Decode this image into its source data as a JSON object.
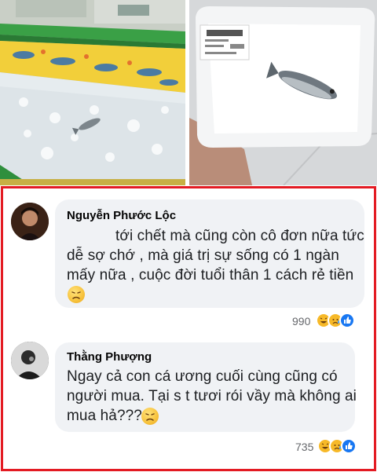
{
  "comments": [
    {
      "author": "Nguyễn Phước Lộc",
      "lines": [
        "tới chết mà cũng còn cô đơn nữa tức",
        "dễ sợ chớ , mà giá trị sự sống có 1 ngàn",
        "mấy nữa , cuộc đời tuổi thân 1 cách rẻ tiền"
      ],
      "emoji": "disappointed-face-icon",
      "reaction_count": "990",
      "reactions": [
        "laugh-react-icon",
        "sad-react-icon",
        "like-react-icon"
      ]
    },
    {
      "author": "Thằng Phượng",
      "lines": [
        "Ngay cả con cá ương cuối cùng cũng có",
        "người mua. Tại s t tươi rói vầy mà không ai",
        "mua hả???"
      ],
      "emoji": "disappointed-face-icon",
      "reaction_count": "735",
      "reactions": [
        "laugh-react-icon",
        "sad-react-icon",
        "like-react-icon"
      ]
    }
  ],
  "colors": {
    "frame": "#e31b23",
    "bubble": "#f0f2f5",
    "like_blue": "#1877f2"
  }
}
